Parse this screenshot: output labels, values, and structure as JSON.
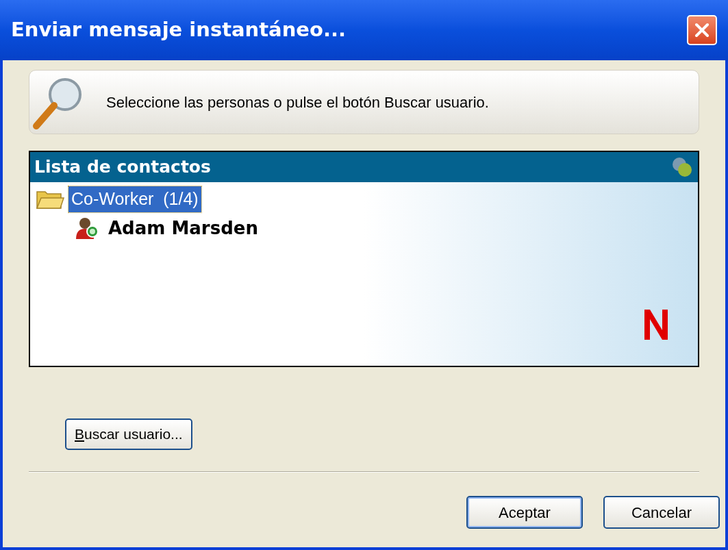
{
  "window": {
    "title": "Enviar mensaje instantáneo..."
  },
  "instruction": "Seleccione las personas o pulse el botón Buscar usuario.",
  "contact_list": {
    "title": "Lista de contactos",
    "tree": [
      {
        "label": "Co-Worker  (1/4)",
        "selected": true,
        "children": [
          {
            "label": "Adam Marsden",
            "selected": false
          }
        ]
      }
    ]
  },
  "search_button": {
    "label": "Buscar usuario...",
    "access_key_underlined": true
  },
  "buttons": [
    {
      "label": "Aceptar",
      "default": true
    },
    {
      "label": "Cancelar",
      "default": false
    }
  ]
}
